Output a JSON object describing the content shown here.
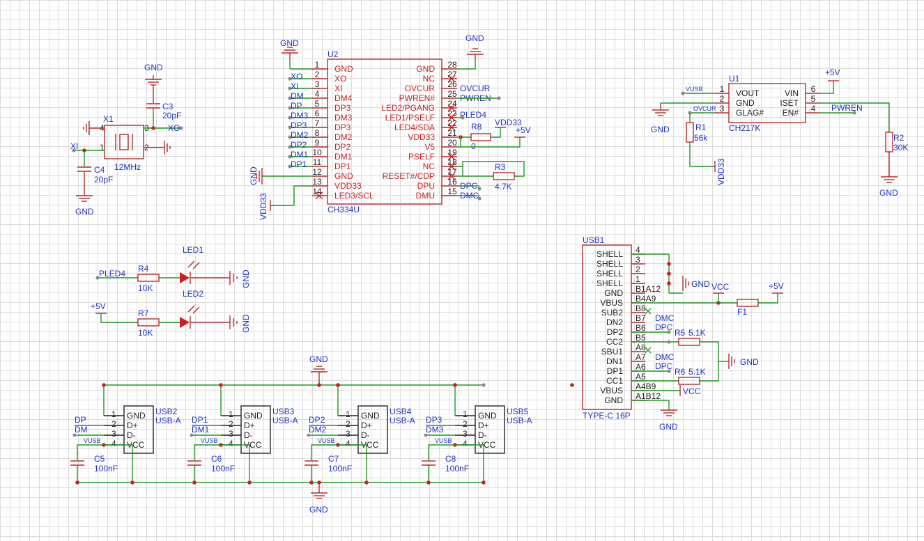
{
  "schematic": {
    "ground": "GND",
    "colors": {
      "wire": "#1e9a1e",
      "component": "#b82a2a",
      "net_label": "#1f32c8",
      "pin_text": "#cc1f1f",
      "grid": "#dcdcdc"
    },
    "crystal": {
      "x1": "X1",
      "x1_value": "12MHz",
      "c3": "C3",
      "c3_value": "20pF",
      "c4": "C4",
      "c4_value": "20pF",
      "net_xo": "XO",
      "net_xi": "XI",
      "pins": [
        "1",
        "2",
        "3",
        "4"
      ]
    },
    "u2": {
      "designator": "U2",
      "part": "CH334U",
      "left_pins": [
        {
          "num": "1",
          "name": "GND",
          "net": ""
        },
        {
          "num": "2",
          "name": "XO",
          "net": "XO"
        },
        {
          "num": "3",
          "name": "XI",
          "net": "XI"
        },
        {
          "num": "4",
          "name": "DM4",
          "net": "DM"
        },
        {
          "num": "5",
          "name": "DP3",
          "net": "DP"
        },
        {
          "num": "6",
          "name": "DM3",
          "net": "DM3"
        },
        {
          "num": "7",
          "name": "DP3",
          "net": "DP3"
        },
        {
          "num": "8",
          "name": "DM2",
          "net": "DM2"
        },
        {
          "num": "9",
          "name": "DP2",
          "net": "DP2"
        },
        {
          "num": "10",
          "name": "DM1",
          "net": "DM1"
        },
        {
          "num": "11",
          "name": "DP1",
          "net": "DP1"
        },
        {
          "num": "12",
          "name": "GND",
          "net": ""
        },
        {
          "num": "13",
          "name": "VDD33",
          "net": ""
        },
        {
          "num": "14",
          "name": "LED3/SCL",
          "net": ""
        }
      ],
      "right_pins": [
        {
          "num": "28",
          "name": "GND",
          "net": ""
        },
        {
          "num": "27",
          "name": "NC",
          "net": ""
        },
        {
          "num": "26",
          "name": "OVCUR",
          "net": "OVCUR"
        },
        {
          "num": "25",
          "name": "PWREN#",
          "net": "PWREN"
        },
        {
          "num": "24",
          "name": "LED2/PGANG",
          "net": ""
        },
        {
          "num": "23",
          "name": "LED1/PSELF",
          "net": "PLED4"
        },
        {
          "num": "22",
          "name": "LED4/SDA",
          "net": ""
        },
        {
          "num": "21",
          "name": "VDD33",
          "net": ""
        },
        {
          "num": "20",
          "name": "V5",
          "net": ""
        },
        {
          "num": "19",
          "name": "PSELF",
          "net": ""
        },
        {
          "num": "18",
          "name": "NC",
          "net": ""
        },
        {
          "num": "17",
          "name": "RESET#/CDP",
          "net": ""
        },
        {
          "num": "16",
          "name": "DPU",
          "net": "DPC"
        },
        {
          "num": "15",
          "name": "DMU",
          "net": "DMC"
        }
      ],
      "vdd33": "VDD33",
      "p5v": "+5V",
      "r8": "R8",
      "r8_value": "0",
      "r3": "R3",
      "r3_value": "4.7K"
    },
    "u1": {
      "designator": "U1",
      "part": "CH217K",
      "left_pins": [
        {
          "num": "1",
          "name": "VOUT",
          "net": "VUSB"
        },
        {
          "num": "2",
          "name": "GND",
          "net": ""
        },
        {
          "num": "3",
          "name": "GLAG#",
          "net": "OVCUR"
        }
      ],
      "right_pins": [
        {
          "num": "6",
          "name": "VIN",
          "net": "+5V"
        },
        {
          "num": "5",
          "name": "ISET",
          "net": ""
        },
        {
          "num": "4",
          "name": "EN#",
          "net": "PWREN"
        }
      ],
      "r1": "R1",
      "r1_value": "56k",
      "r2": "R2",
      "r2_value": "30K",
      "vdd33": "VDD33"
    },
    "leds": {
      "pled4": "PLED4",
      "p5v": "+5V",
      "r4": "R4",
      "r4_value": "10K",
      "r7": "R7",
      "r7_value": "10K",
      "led1": "LED1",
      "led2": "LED2"
    },
    "usb_ports": [
      {
        "designator": "USB2",
        "part": "USB-A",
        "dp": "DP",
        "dm": "DM",
        "cap": "C5",
        "cap_value": "100nF"
      },
      {
        "designator": "USB3",
        "part": "USB-A",
        "dp": "DP1",
        "dm": "DM1",
        "cap": "C6",
        "cap_value": "100nF"
      },
      {
        "designator": "USB4",
        "part": "USB-A",
        "dp": "DP2",
        "dm": "DM2",
        "cap": "C7",
        "cap_value": "100nF"
      },
      {
        "designator": "USB5",
        "part": "USB-A",
        "dp": "DP3",
        "dm": "DM3",
        "cap": "C8",
        "cap_value": "100nF"
      }
    ],
    "usb_a_pins": [
      {
        "num": "1",
        "name": "GND"
      },
      {
        "num": "2",
        "name": "D+"
      },
      {
        "num": "3",
        "name": "D-"
      },
      {
        "num": "4",
        "name": "VCC"
      }
    ],
    "vusb": "VUSB",
    "usb1": {
      "designator": "USB1",
      "part": "TYPE-C 16P",
      "rows": [
        {
          "name": "SHELL",
          "pin": "4"
        },
        {
          "name": "SHELL",
          "pin": "3"
        },
        {
          "name": "SHELL",
          "pin": "2"
        },
        {
          "name": "SHELL",
          "pin": "1"
        },
        {
          "name": "GND",
          "pin": "B1A12"
        },
        {
          "name": "VBUS",
          "pin": "B4A9"
        },
        {
          "name": "SUB2",
          "pin": "B8"
        },
        {
          "name": "DN2",
          "pin": "B7"
        },
        {
          "name": "DP2",
          "pin": "B6"
        },
        {
          "name": "CC2",
          "pin": "B5"
        },
        {
          "name": "SBU1",
          "pin": "A8"
        },
        {
          "name": "DN1",
          "pin": "A7"
        },
        {
          "name": "DP1",
          "pin": "A6"
        },
        {
          "name": "CC1",
          "pin": "A5"
        },
        {
          "name": "VBUS",
          "pin": "A4B9"
        },
        {
          "name": "GND",
          "pin": "A1B12"
        }
      ],
      "dmc": "DMC",
      "dpc": "DPC",
      "vcc": "VCC",
      "p5v": "+5V",
      "f1": "F1",
      "r5": "R5",
      "r5_value": "5.1K",
      "r6": "R6",
      "r6_value": "5.1K"
    }
  }
}
